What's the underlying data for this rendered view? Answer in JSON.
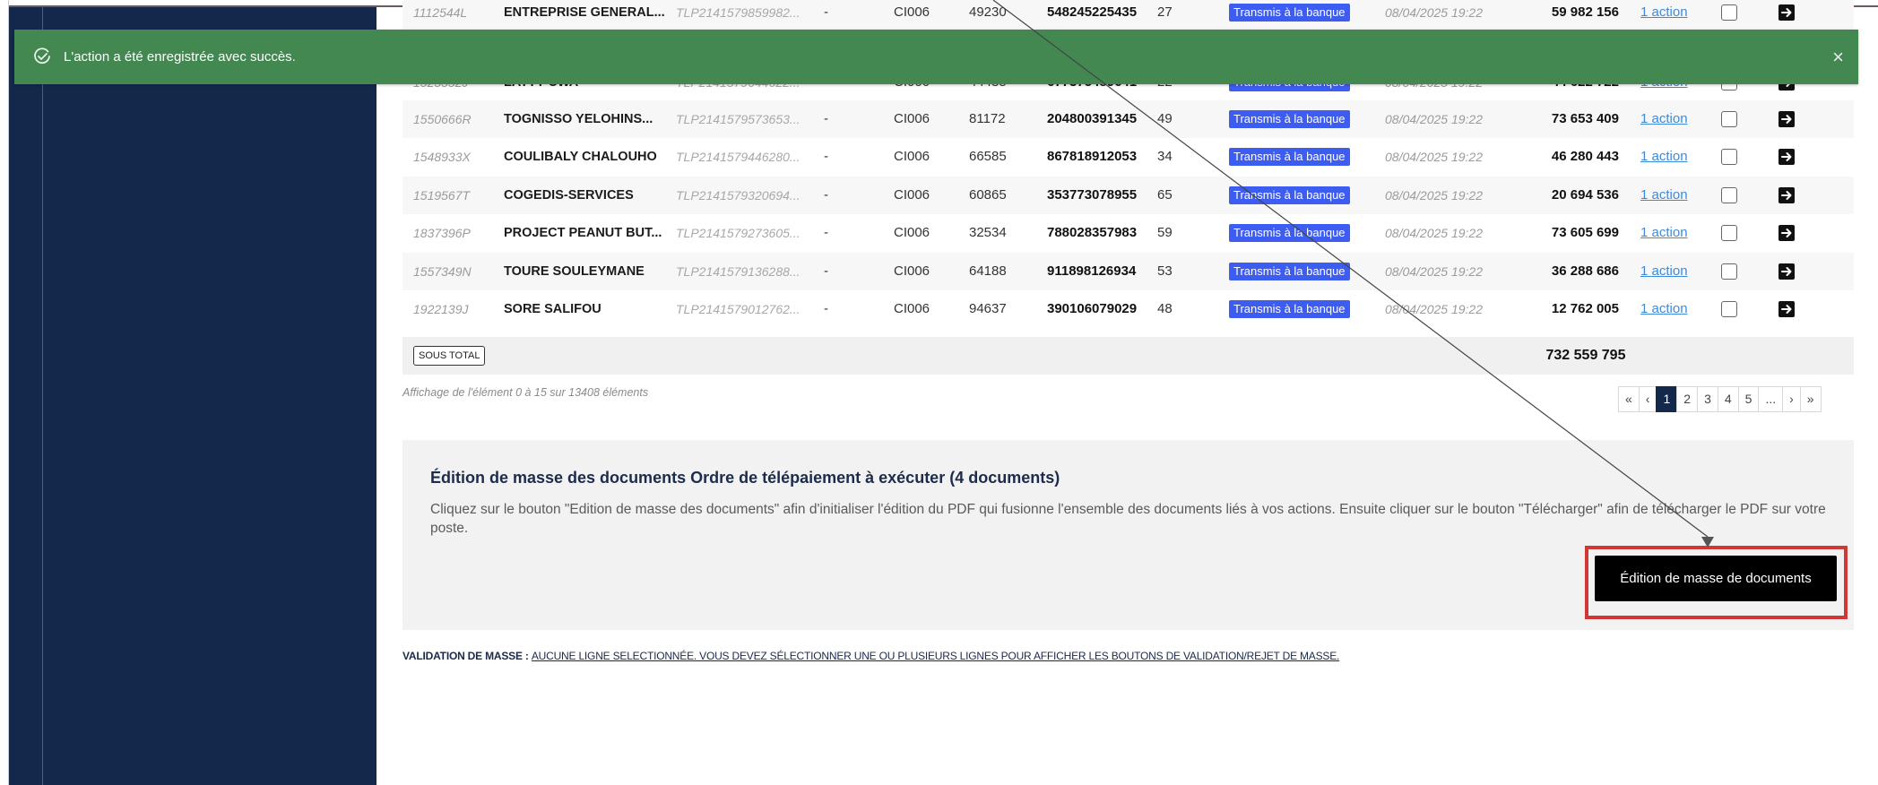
{
  "toast": {
    "message": "L'action a été enregistrée avec succès.",
    "close_symbol": "×",
    "color": "#438751"
  },
  "table": {
    "rows": [
      {
        "id": "1112544L",
        "name": "ENTREPRISE GENERAL...",
        "ref": "TLP2141579859982...",
        "dash": "-",
        "code": "CI006",
        "num": "49230",
        "account": "548245225435",
        "days": "27",
        "status": "Transmis à la banque",
        "date": "08/04/2025 19:22",
        "amount": "59 982 156",
        "action": "1 action"
      },
      {
        "id": "1525552J",
        "name": "LATTY CWA",
        "ref": "TLP2141579644622...",
        "dash": "-",
        "code": "CI006",
        "num": "44485",
        "account": "677375489641",
        "days": "22",
        "status": "Transmis à la banque",
        "date": "08/04/2025 19:22",
        "amount": "44 622 722",
        "action": "1 action"
      },
      {
        "id": "1550666R",
        "name": "TOGNISSO YELOHINS...",
        "ref": "TLP2141579573653...",
        "dash": "-",
        "code": "CI006",
        "num": "81172",
        "account": "204800391345",
        "days": "49",
        "status": "Transmis à la banque",
        "date": "08/04/2025 19:22",
        "amount": "73 653 409",
        "action": "1 action"
      },
      {
        "id": "1548933X",
        "name": "COULIBALY CHALOUHO",
        "ref": "TLP2141579446280...",
        "dash": "-",
        "code": "CI006",
        "num": "66585",
        "account": "867818912053",
        "days": "34",
        "status": "Transmis à la banque",
        "date": "08/04/2025 19:22",
        "amount": "46 280 443",
        "action": "1 action"
      },
      {
        "id": "1519567T",
        "name": "COGEDIS-SERVICES",
        "ref": "TLP2141579320694...",
        "dash": "-",
        "code": "CI006",
        "num": "60865",
        "account": "353773078955",
        "days": "65",
        "status": "Transmis à la banque",
        "date": "08/04/2025 19:22",
        "amount": "20 694 536",
        "action": "1 action"
      },
      {
        "id": "1837396P",
        "name": "PROJECT PEANUT BUT...",
        "ref": "TLP2141579273605...",
        "dash": "-",
        "code": "CI006",
        "num": "32534",
        "account": "788028357983",
        "days": "59",
        "status": "Transmis à la banque",
        "date": "08/04/2025 19:22",
        "amount": "73 605 699",
        "action": "1 action"
      },
      {
        "id": "1557349N",
        "name": "TOURE SOULEYMANE",
        "ref": "TLP2141579136288...",
        "dash": "-",
        "code": "CI006",
        "num": "64188",
        "account": "911898126934",
        "days": "53",
        "status": "Transmis à la banque",
        "date": "08/04/2025 19:22",
        "amount": "36 288 686",
        "action": "1 action"
      },
      {
        "id": "1922139J",
        "name": "SORE SALIFOU",
        "ref": "TLP2141579012762...",
        "dash": "-",
        "code": "CI006",
        "num": "94637",
        "account": "390106079029",
        "days": "48",
        "status": "Transmis à la banque",
        "date": "08/04/2025 19:22",
        "amount": "12 762 005",
        "action": "1 action"
      }
    ],
    "subtotal_label": "SOUS TOTAL",
    "subtotal_value": "732 559 795",
    "status_color": "#3d5cf0"
  },
  "info": {
    "showing": "Affichage de l'élément 0 à 15 sur 13408 éléments"
  },
  "pagination": {
    "first": "«",
    "prev": "‹",
    "pages": [
      "1",
      "2",
      "3",
      "4",
      "5",
      "..."
    ],
    "current": "1",
    "next": "›",
    "last": "»"
  },
  "mass_edit": {
    "title": "Édition de masse des documents Ordre de télépaiement à exécuter (4 documents)",
    "description": "Cliquez sur le bouton \"Edition de masse des documents\" afin d'initialiser l'édition du PDF qui fusionne l'ensemble des documents liés à vos actions. Ensuite cliquer sur le bouton \"Télécharger\" afin de télécharger le PDF sur votre poste.",
    "button_label": "Édition de masse de documents",
    "highlight_color": "#d03838"
  },
  "validation": {
    "label": "VALIDATION DE MASSE :",
    "message": "AUCUNE LIGNE SELECTIONNÉE. VOUS DEVEZ SÉLECTIONNER UNE OU PLUSIEURS LIGNES POUR AFFICHER LES BOUTONS DE VALIDATION/REJET DE MASSE."
  },
  "theme": {
    "sidebar_color": "#14284b"
  }
}
